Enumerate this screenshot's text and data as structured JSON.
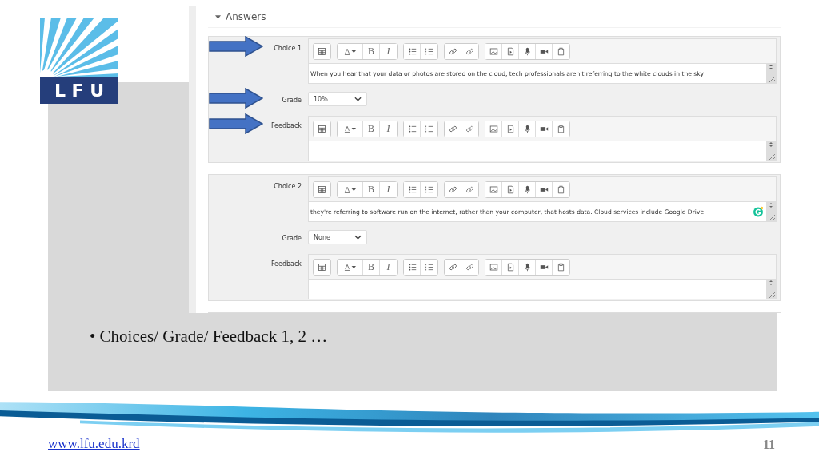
{
  "logo": {
    "text": "L F U"
  },
  "screenshot": {
    "section_title": "Answers",
    "answers": [
      {
        "fields": [
          {
            "kind": "editor",
            "label": "Choice 1",
            "arrow": true,
            "bold": "B",
            "italic": "I",
            "text": "When you hear that your data or photos are stored on the cloud, tech professionals aren't referring to the white clouds in the sky",
            "assistant_badge": false
          },
          {
            "kind": "select",
            "label": "Grade",
            "arrow": true,
            "value": "10%"
          },
          {
            "kind": "editor",
            "label": "Feedback",
            "arrow": true,
            "bold": "B",
            "italic": "I",
            "assistant_badge": false
          }
        ]
      },
      {
        "fields": [
          {
            "kind": "editor",
            "label": "Choice 2",
            "arrow": false,
            "bold": "B",
            "italic": "I",
            "text": "they're referring to software run on the internet, rather than your computer, that hosts data. Cloud services include Google Drive",
            "assistant_badge": true
          },
          {
            "kind": "select",
            "label": "Grade",
            "arrow": false,
            "value": "None"
          },
          {
            "kind": "editor",
            "label": "Feedback",
            "arrow": false,
            "bold": "B",
            "italic": "I",
            "assistant_badge": false
          }
        ]
      }
    ]
  },
  "bullets": [
    "• Choices/ Grade/ Feedback 1, 2 …"
  ],
  "footer": {
    "url": "www.lfu.edu.krd",
    "page_number": "11"
  }
}
